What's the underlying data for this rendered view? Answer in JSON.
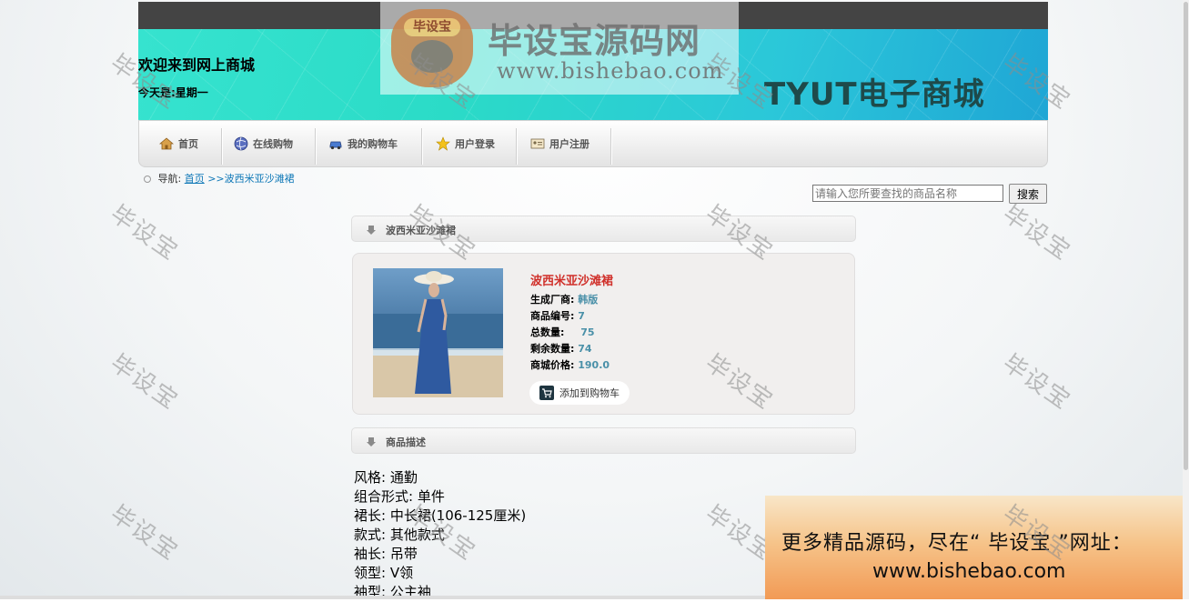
{
  "header": {
    "welcome": "欢迎来到网上商城",
    "today": "今天是:星期一",
    "brand": "TYUT电子商城"
  },
  "watermark": {
    "tag": "毕设宝",
    "title": "毕设宝源码网",
    "url": "www.bishebao.com",
    "diagonal_text": "毕设宝"
  },
  "nav": {
    "items": [
      {
        "label": "首页",
        "icon": "home-icon"
      },
      {
        "label": "在线购物",
        "icon": "globe-icon"
      },
      {
        "label": "我的购物车",
        "icon": "car-icon"
      },
      {
        "label": "用户登录",
        "icon": "star-icon"
      },
      {
        "label": "用户注册",
        "icon": "id-card-icon"
      }
    ]
  },
  "breadcrumb": {
    "prefix": "导航:",
    "home": "首页",
    "current": ">>波西米亚沙滩裙"
  },
  "search": {
    "placeholder": "请输入您所要查找的商品名称",
    "button": "搜索"
  },
  "product": {
    "section_title": "波西米亚沙滩裙",
    "name": "波西米亚沙滩裙",
    "fields": [
      {
        "label": "生成厂商:",
        "value": "韩版"
      },
      {
        "label": "商品编号:",
        "value": "7"
      },
      {
        "label": "总数量:",
        "value": "75"
      },
      {
        "label": "剩余数量:",
        "value": "74"
      },
      {
        "label": "商城价格:",
        "value": "190.0"
      }
    ],
    "add_to_cart": "添加到购物车"
  },
  "description": {
    "section_title": "商品描述",
    "lines": [
      "风格: 通勤",
      "组合形式: 单件",
      "裙长: 中长裙(106-125厘米)",
      "款式: 其他款式",
      "袖长: 吊带",
      "领型: V领",
      "袖型: 公主袖"
    ]
  },
  "ad": {
    "line1": "更多精品源码，尽在“ 毕设宝 ”网址：",
    "line2": "www.bishebao.com"
  },
  "colors": {
    "banner_start": "#36e3cf",
    "banner_end": "#1fa6d5",
    "price_blue": "#4a90a8",
    "name_red": "#d0302a",
    "link_blue": "#0f78b7"
  }
}
